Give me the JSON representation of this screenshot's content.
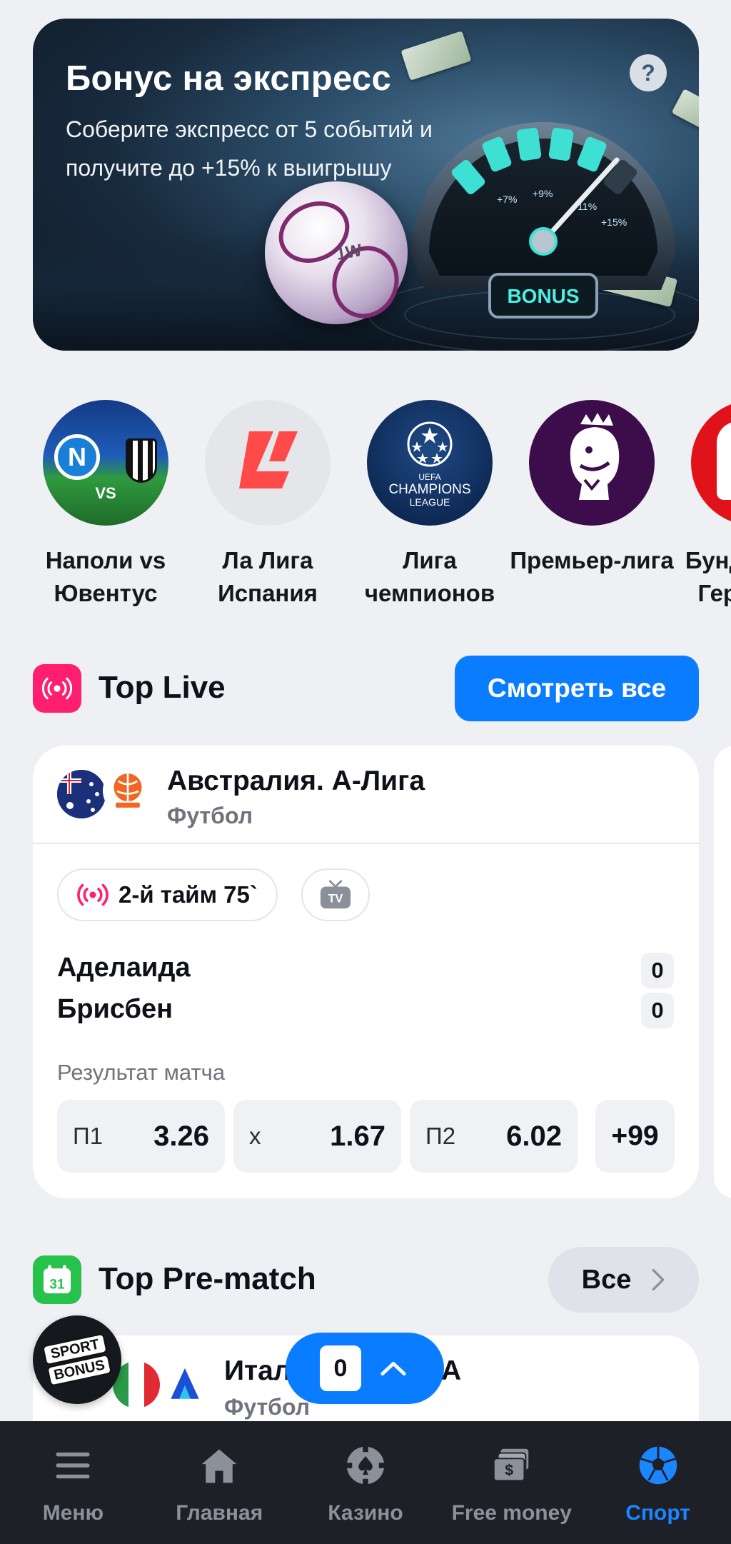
{
  "banner": {
    "title": "Бонус на экспресс",
    "text": "Соберите экспресс от 5 событий и получите до +15% к выигрышу",
    "help": "?",
    "gauge_labels": [
      "+7%",
      "+9%",
      "+11%",
      "+15%"
    ],
    "gauge_badge": "BONUS",
    "ball_mark": "1W"
  },
  "leagues": [
    {
      "label": "Наполи vs Ювентус",
      "badge": "VS"
    },
    {
      "label": "Ла Лига Испания"
    },
    {
      "label": "Лига чемпионов",
      "logo_lines": [
        "UEFA",
        "CHAMPIONS",
        "LEAGUE"
      ]
    },
    {
      "label": "Премьер-лига"
    },
    {
      "label": "Бундеслига Германия"
    }
  ],
  "top_live": {
    "title": "Top Live",
    "see_all": "Смотреть все",
    "match": {
      "competition": "Австралия. А-Лига",
      "sport": "Футбол",
      "status": "2-й тайм 75`",
      "tv_badge": "TV",
      "home": "Аделаида",
      "away": "Брисбен",
      "home_score": "0",
      "away_score": "0",
      "market": "Результат матча",
      "odds": [
        {
          "label": "П1",
          "value": "3.26"
        },
        {
          "label": "х",
          "value": "1.67"
        },
        {
          "label": "П2",
          "value": "6.02"
        }
      ],
      "more": "+99"
    }
  },
  "top_prematch": {
    "title": "Top Pre-match",
    "calendar_day": "31",
    "all": "Все",
    "match": {
      "competition_start": "Итал",
      "competition_end": "А",
      "sport": "Футбол"
    }
  },
  "floating": {
    "sport_bonus": [
      "SPORT",
      "BONUS"
    ],
    "betslip_count": "0"
  },
  "nav": [
    {
      "label": "Меню",
      "icon": "menu-icon"
    },
    {
      "label": "Главная",
      "icon": "home-icon"
    },
    {
      "label": "Казино",
      "icon": "casino-chip-icon"
    },
    {
      "label": "Free money",
      "icon": "money-icon"
    },
    {
      "label": "Спорт",
      "icon": "soccer-ball-icon",
      "active": true
    }
  ],
  "colors": {
    "accent": "#0a7cff",
    "live": "#ff1f6e",
    "prematch": "#27c24c",
    "nav_bg": "#1d2026"
  }
}
